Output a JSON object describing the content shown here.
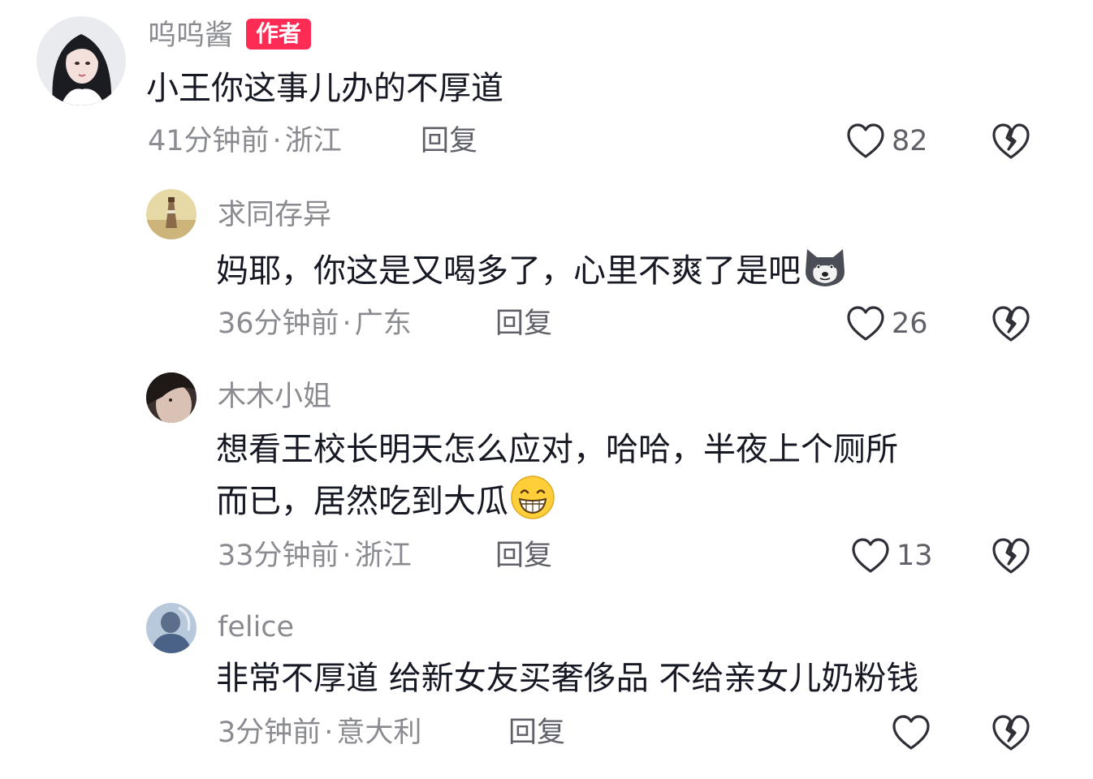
{
  "comments": [
    {
      "user": "呜呜酱",
      "badge": "作者",
      "text": "小王你这事儿办的不厚道",
      "time": "41分钟前",
      "location": "浙江",
      "reply_label": "回复",
      "likes": "82",
      "avatar_icon": "avatar-girl-long-hair"
    },
    {
      "user": "求同存异",
      "text": "妈耶，你这是又喝多了，心里不爽了是吧",
      "emoji": "husky-dog-emoji",
      "time": "36分钟前",
      "location": "广东",
      "reply_label": "回复",
      "likes": "26",
      "avatar_icon": "avatar-lighthouse"
    },
    {
      "user": "木木小姐",
      "text_line1": "想看王校长明天怎么应对，哈哈，半夜上个厕所",
      "text_line2": "而已，居然吃到大瓜",
      "emoji": "grinning-face-emoji",
      "time": "33分钟前",
      "location": "浙江",
      "reply_label": "回复",
      "likes": "13",
      "avatar_icon": "avatar-dark-portrait"
    },
    {
      "user": "felice",
      "text": "非常不厚道 给新女友买奢侈品 不给亲女儿奶粉钱",
      "time": "3分钟前",
      "location": "意大利",
      "reply_label": "回复",
      "likes": "",
      "avatar_icon": "avatar-blue-person"
    }
  ],
  "meta_separator": "·",
  "colors": {
    "badge": "#fe2c55",
    "secondary_text": "#8a8b91",
    "primary_text": "#161823"
  }
}
